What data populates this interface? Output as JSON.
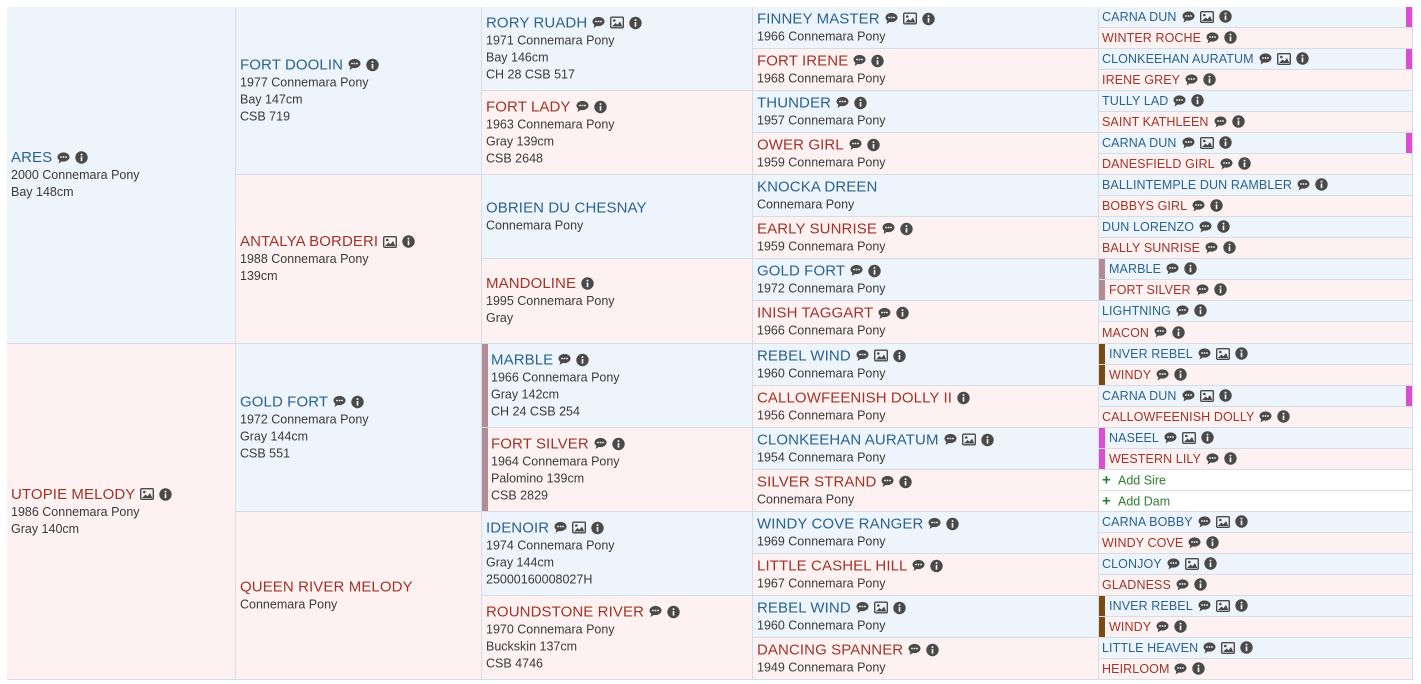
{
  "icons": {
    "comment": "comment-icon",
    "photo": "photo-icon",
    "info": "info-icon",
    "add": "plus-icon"
  },
  "colors": {
    "sire_name": "#2a6391",
    "dam_name": "#a1342a",
    "sire_bg": "#eef4fb",
    "dam_bg": "#fdf2f1",
    "add_text": "#2e7d32",
    "marker_gray": "#b28b95",
    "marker_magenta": "#d94fcf",
    "marker_brown": "#7a4a12"
  },
  "pedigree": {
    "gen1": [
      {
        "name": "ARES",
        "sex": "sire",
        "icons": [
          "comment",
          "info"
        ],
        "lines": [
          "2000 Connemara Pony",
          "Bay 148cm"
        ]
      },
      {
        "name": "UTOPIE MELODY",
        "sex": "dam",
        "icons": [
          "photo",
          "info"
        ],
        "lines": [
          "1986 Connemara Pony",
          "Gray 140cm"
        ]
      }
    ],
    "gen2": [
      {
        "name": "FORT DOOLIN",
        "sex": "sire",
        "icons": [
          "comment",
          "info"
        ],
        "lines": [
          "1977 Connemara Pony",
          "Bay 147cm",
          "CSB 719"
        ]
      },
      {
        "name": "ANTALYA BORDERI",
        "sex": "dam",
        "icons": [
          "photo",
          "info"
        ],
        "lines": [
          "1988 Connemara Pony",
          "139cm"
        ]
      },
      {
        "name": "GOLD FORT",
        "sex": "sire",
        "icons": [
          "comment",
          "info"
        ],
        "lines": [
          "1972 Connemara Pony",
          "Gray 144cm",
          "CSB 551"
        ]
      },
      {
        "name": "QUEEN RIVER MELODY",
        "sex": "dam",
        "icons": [],
        "lines": [
          "Connemara Pony"
        ]
      }
    ],
    "gen3": [
      {
        "name": "RORY RUADH",
        "sex": "sire",
        "icons": [
          "comment",
          "photo",
          "info"
        ],
        "lines": [
          "1971 Connemara Pony",
          "Bay 146cm",
          "CH 28 CSB 517"
        ]
      },
      {
        "name": "FORT LADY",
        "sex": "dam",
        "icons": [
          "comment",
          "info"
        ],
        "lines": [
          "1963 Connemara Pony",
          "Gray 139cm",
          "CSB 2648"
        ]
      },
      {
        "name": "OBRIEN DU CHESNAY",
        "sex": "sire",
        "icons": [],
        "lines": [
          "Connemara Pony"
        ]
      },
      {
        "name": "MANDOLINE",
        "sex": "dam",
        "icons": [
          "info"
        ],
        "lines": [
          "1995 Connemara Pony",
          "Gray"
        ]
      },
      {
        "name": "MARBLE",
        "sex": "sire",
        "icons": [
          "comment",
          "info"
        ],
        "lines": [
          "1966 Connemara Pony",
          "Gray 142cm",
          "CH 24 CSB 254"
        ],
        "marker": "gray"
      },
      {
        "name": "FORT SILVER",
        "sex": "dam",
        "icons": [
          "comment",
          "info"
        ],
        "lines": [
          "1964 Connemara Pony",
          "Palomino 139cm",
          "CSB 2829"
        ],
        "marker": "gray"
      },
      {
        "name": "IDENOIR",
        "sex": "sire",
        "icons": [
          "comment",
          "photo",
          "info"
        ],
        "lines": [
          "1974 Connemara Pony",
          "Gray 144cm",
          "25000160008027H"
        ]
      },
      {
        "name": "ROUNDSTONE RIVER",
        "sex": "dam",
        "icons": [
          "comment",
          "info"
        ],
        "lines": [
          "1970 Connemara Pony",
          "Buckskin 137cm",
          "CSB 4746"
        ]
      }
    ],
    "gen4": [
      {
        "name": "FINNEY MASTER",
        "sex": "sire",
        "icons": [
          "comment",
          "photo",
          "info"
        ],
        "lines": [
          "1966 Connemara Pony"
        ]
      },
      {
        "name": "FORT IRENE",
        "sex": "dam",
        "icons": [
          "comment",
          "info"
        ],
        "lines": [
          "1968 Connemara Pony"
        ]
      },
      {
        "name": "THUNDER",
        "sex": "sire",
        "icons": [
          "comment",
          "info"
        ],
        "lines": [
          "1957 Connemara Pony"
        ]
      },
      {
        "name": "OWER GIRL",
        "sex": "dam",
        "icons": [
          "comment",
          "info"
        ],
        "lines": [
          "1959 Connemara Pony"
        ]
      },
      {
        "name": "KNOCKA DREEN",
        "sex": "sire",
        "icons": [],
        "lines": [
          "Connemara Pony"
        ]
      },
      {
        "name": "EARLY SUNRISE",
        "sex": "dam",
        "icons": [
          "comment",
          "info"
        ],
        "lines": [
          "1959 Connemara Pony"
        ]
      },
      {
        "name": "GOLD FORT",
        "sex": "sire",
        "icons": [
          "comment",
          "info"
        ],
        "lines": [
          "1972 Connemara Pony"
        ]
      },
      {
        "name": "INISH TAGGART",
        "sex": "dam",
        "icons": [
          "comment",
          "info"
        ],
        "lines": [
          "1966 Connemara Pony"
        ]
      },
      {
        "name": "REBEL WIND",
        "sex": "sire",
        "icons": [
          "comment",
          "photo",
          "info"
        ],
        "lines": [
          "1960 Connemara Pony"
        ]
      },
      {
        "name": "CALLOWFEENISH DOLLY II",
        "sex": "dam",
        "icons": [
          "info"
        ],
        "lines": [
          "1956 Connemara Pony"
        ]
      },
      {
        "name": "CLONKEEHAN AURATUM",
        "sex": "sire",
        "icons": [
          "comment",
          "photo",
          "info"
        ],
        "lines": [
          "1954 Connemara Pony"
        ]
      },
      {
        "name": "SILVER STRAND",
        "sex": "dam",
        "icons": [
          "comment",
          "info"
        ],
        "lines": [
          "Connemara Pony"
        ]
      },
      {
        "name": "WINDY COVE RANGER",
        "sex": "sire",
        "icons": [
          "comment",
          "info"
        ],
        "lines": [
          "1969 Connemara Pony"
        ]
      },
      {
        "name": "LITTLE CASHEL HILL",
        "sex": "dam",
        "icons": [
          "comment",
          "info"
        ],
        "lines": [
          "1967 Connemara Pony"
        ]
      },
      {
        "name": "REBEL WIND",
        "sex": "sire",
        "icons": [
          "comment",
          "photo",
          "info"
        ],
        "lines": [
          "1960 Connemara Pony"
        ]
      },
      {
        "name": "DANCING SPANNER",
        "sex": "dam",
        "icons": [
          "comment",
          "info"
        ],
        "lines": [
          "1949 Connemara Pony"
        ]
      }
    ],
    "gen5": [
      {
        "name": "CARNA DUN",
        "sex": "sire",
        "icons": [
          "comment",
          "photo",
          "info"
        ],
        "marker": "magenta-right"
      },
      {
        "name": "WINTER ROCHE",
        "sex": "dam",
        "icons": [
          "comment",
          "info"
        ]
      },
      {
        "name": "CLONKEEHAN AURATUM",
        "sex": "sire",
        "icons": [
          "comment",
          "photo",
          "info"
        ],
        "marker": "magenta-right"
      },
      {
        "name": "IRENE GREY",
        "sex": "dam",
        "icons": [
          "comment",
          "info"
        ]
      },
      {
        "name": "TULLY LAD",
        "sex": "sire",
        "icons": [
          "comment",
          "info"
        ]
      },
      {
        "name": "SAINT KATHLEEN",
        "sex": "dam",
        "icons": [
          "comment",
          "info"
        ]
      },
      {
        "name": "CARNA DUN",
        "sex": "sire",
        "icons": [
          "comment",
          "photo",
          "info"
        ],
        "marker": "magenta-right"
      },
      {
        "name": "DANESFIELD GIRL",
        "sex": "dam",
        "icons": [
          "comment",
          "info"
        ]
      },
      {
        "name": "BALLINTEMPLE DUN RAMBLER",
        "sex": "sire",
        "icons": [
          "comment",
          "info"
        ]
      },
      {
        "name": "BOBBYS GIRL",
        "sex": "dam",
        "icons": [
          "comment",
          "info"
        ]
      },
      {
        "name": "DUN LORENZO",
        "sex": "sire",
        "icons": [
          "comment",
          "info"
        ]
      },
      {
        "name": "BALLY SUNRISE",
        "sex": "dam",
        "icons": [
          "comment",
          "info"
        ]
      },
      {
        "name": "MARBLE",
        "sex": "sire",
        "icons": [
          "comment",
          "info"
        ],
        "marker": "gray"
      },
      {
        "name": "FORT SILVER",
        "sex": "dam",
        "icons": [
          "comment",
          "info"
        ],
        "marker": "gray"
      },
      {
        "name": "LIGHTNING",
        "sex": "sire",
        "icons": [
          "comment",
          "info"
        ]
      },
      {
        "name": "MACON",
        "sex": "dam",
        "icons": [
          "comment",
          "info"
        ]
      },
      {
        "name": "INVER REBEL",
        "sex": "sire",
        "icons": [
          "comment",
          "photo",
          "info"
        ],
        "marker": "brown"
      },
      {
        "name": "WINDY",
        "sex": "dam",
        "icons": [
          "comment",
          "info"
        ],
        "marker": "brown"
      },
      {
        "name": "CARNA DUN",
        "sex": "sire",
        "icons": [
          "comment",
          "photo",
          "info"
        ],
        "marker": "magenta-right"
      },
      {
        "name": "CALLOWFEENISH DOLLY",
        "sex": "dam",
        "icons": [
          "comment",
          "info"
        ]
      },
      {
        "name": "NASEEL",
        "sex": "sire",
        "icons": [
          "comment",
          "photo",
          "info"
        ],
        "marker": "magenta"
      },
      {
        "name": "WESTERN LILY",
        "sex": "dam",
        "icons": [
          "comment",
          "info"
        ],
        "marker": "magenta"
      },
      {
        "add": true,
        "label": "Add Sire"
      },
      {
        "add": true,
        "label": "Add Dam"
      },
      {
        "name": "CARNA BOBBY",
        "sex": "sire",
        "icons": [
          "comment",
          "photo",
          "info"
        ]
      },
      {
        "name": "WINDY COVE",
        "sex": "dam",
        "icons": [
          "comment",
          "info"
        ]
      },
      {
        "name": "CLONJOY",
        "sex": "sire",
        "icons": [
          "comment",
          "photo",
          "info"
        ]
      },
      {
        "name": "GLADNESS",
        "sex": "dam",
        "icons": [
          "comment",
          "info"
        ]
      },
      {
        "name": "INVER REBEL",
        "sex": "sire",
        "icons": [
          "comment",
          "photo",
          "info"
        ],
        "marker": "brown"
      },
      {
        "name": "WINDY",
        "sex": "dam",
        "icons": [
          "comment",
          "info"
        ],
        "marker": "brown"
      },
      {
        "name": "LITTLE HEAVEN",
        "sex": "sire",
        "icons": [
          "comment",
          "photo",
          "info"
        ]
      },
      {
        "name": "HEIRLOOM",
        "sex": "dam",
        "icons": [
          "comment",
          "info"
        ]
      }
    ]
  }
}
